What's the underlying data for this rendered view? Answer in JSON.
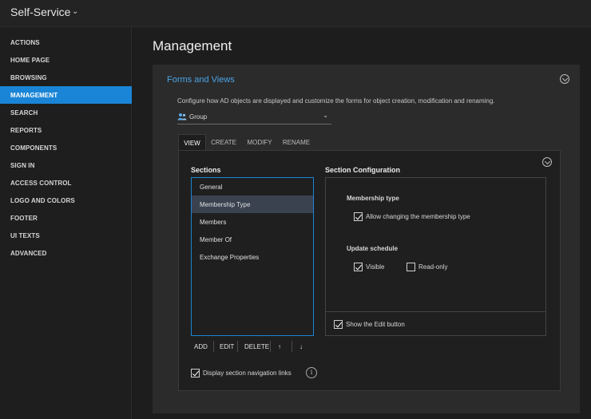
{
  "app": {
    "title": "Self-Service"
  },
  "sidebar": {
    "items": [
      {
        "label": "ACTIONS"
      },
      {
        "label": "HOME PAGE"
      },
      {
        "label": "BROWSING"
      },
      {
        "label": "MANAGEMENT",
        "active": true
      },
      {
        "label": "SEARCH"
      },
      {
        "label": "REPORTS"
      },
      {
        "label": "COMPONENTS"
      },
      {
        "label": "SIGN IN"
      },
      {
        "label": "ACCESS CONTROL"
      },
      {
        "label": "LOGO AND COLORS"
      },
      {
        "label": "FOOTER"
      },
      {
        "label": "UI TEXTS"
      },
      {
        "label": "ADVANCED"
      }
    ]
  },
  "main": {
    "title": "Management",
    "card": {
      "title": "Forms and Views",
      "description": "Configure how AD objects are displayed and customize the forms for object creation, modification and renaming.",
      "object_type": {
        "value": "Group",
        "icon": "group-icon"
      },
      "tabs": [
        {
          "label": "VIEW",
          "active": true
        },
        {
          "label": "CREATE"
        },
        {
          "label": "MODIFY"
        },
        {
          "label": "RENAME"
        }
      ],
      "sections": {
        "heading": "Sections",
        "items": [
          {
            "label": "General"
          },
          {
            "label": "Membership Type",
            "selected": true
          },
          {
            "label": "Members"
          },
          {
            "label": "Member Of"
          },
          {
            "label": "Exchange Properties"
          }
        ],
        "actions": {
          "add": "ADD",
          "edit": "EDIT",
          "delete": "DELETE",
          "up": "↑",
          "down": "↓"
        }
      },
      "config": {
        "heading": "Section Configuration",
        "membership_type_label": "Membership type",
        "allow_change_label": "Allow changing the membership type",
        "allow_change_checked": true,
        "update_schedule_label": "Update schedule",
        "visible_label": "Visible",
        "visible_checked": true,
        "readonly_label": "Read-only",
        "readonly_checked": false,
        "show_edit_label": "Show the Edit button",
        "show_edit_checked": true
      },
      "display_nav_links": {
        "label": "Display section navigation links",
        "checked": true
      }
    }
  },
  "colors": {
    "accent": "#1a85d6",
    "link": "#4aa3e6",
    "background": "#1b1b1b",
    "card": "#2b2b2b"
  }
}
